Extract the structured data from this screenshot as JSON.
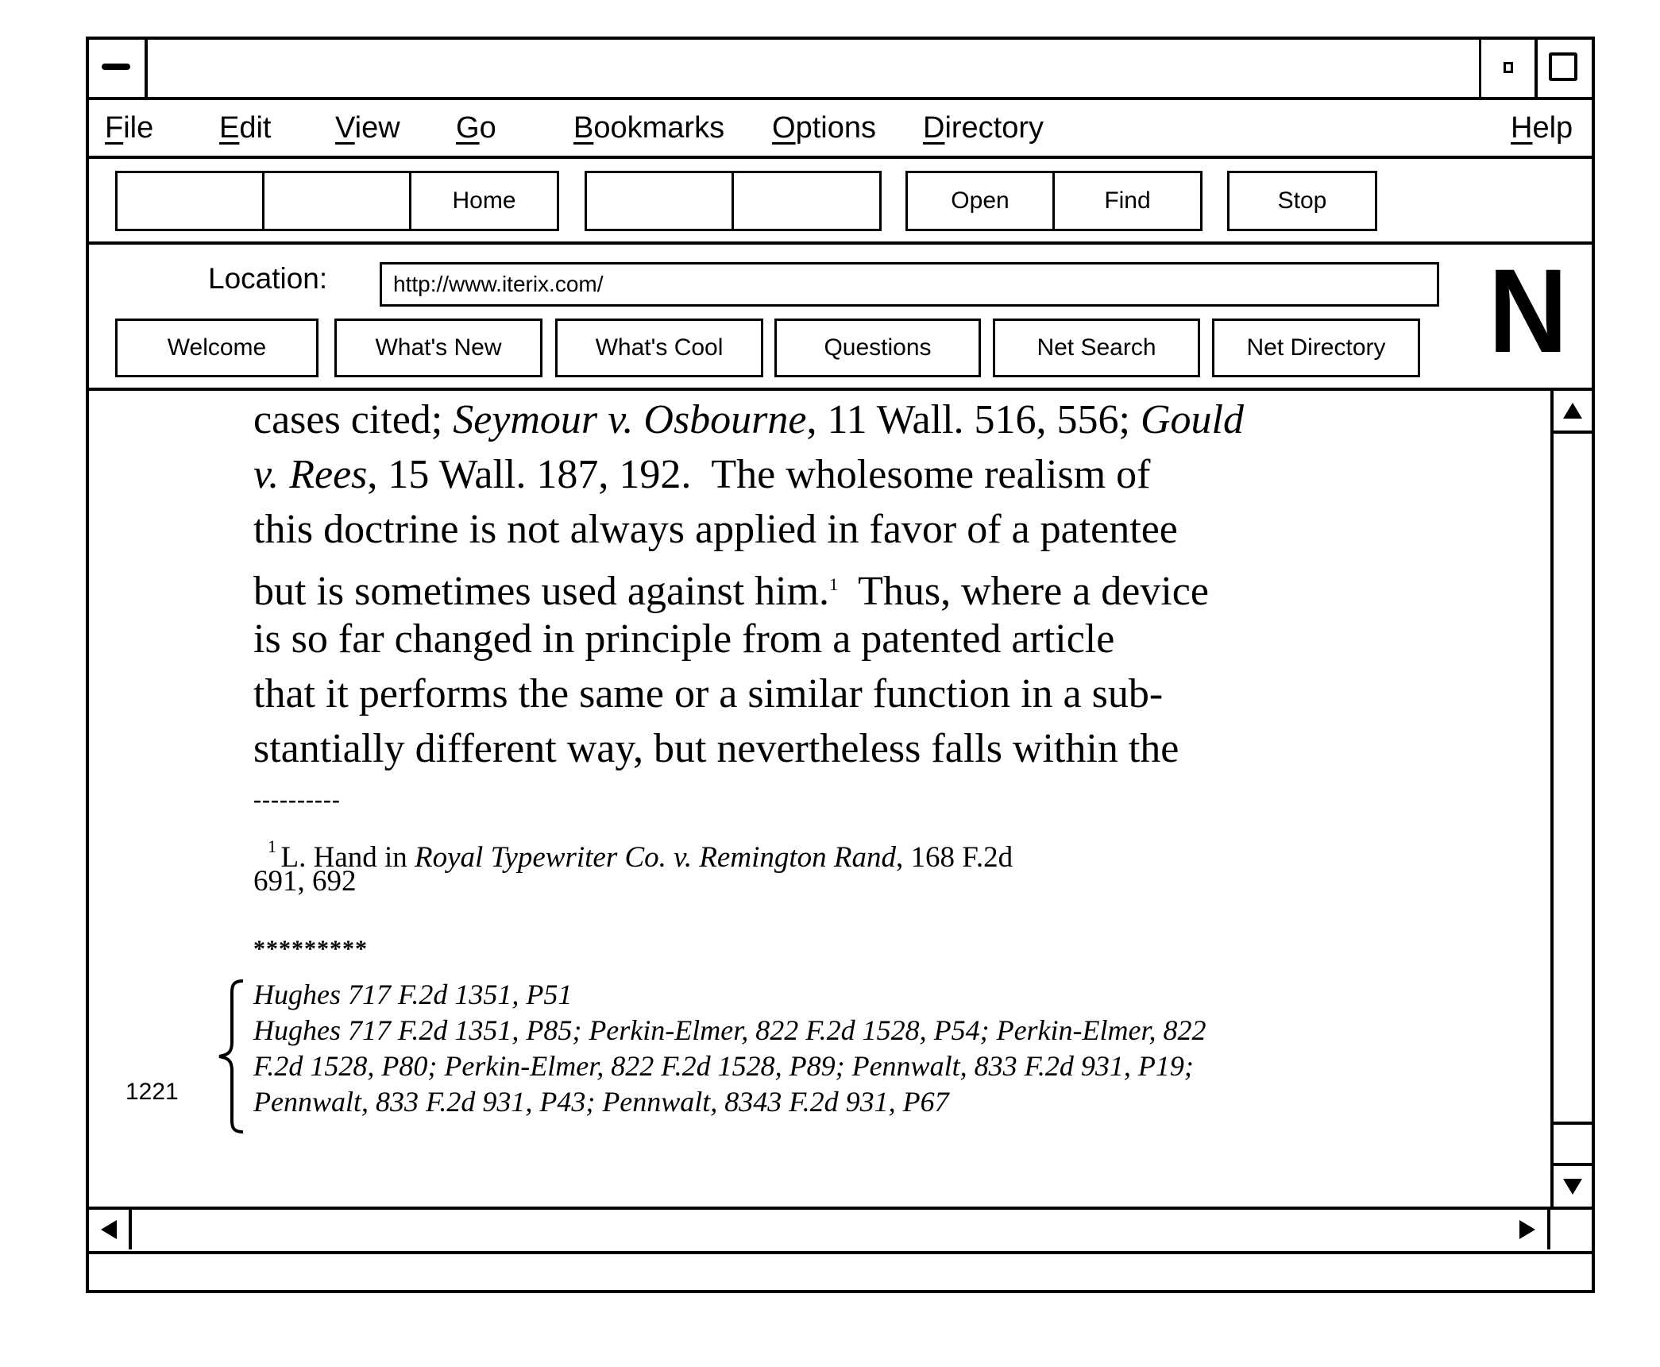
{
  "window": {
    "title": "",
    "controls": {
      "close": "window-menu",
      "minimize": "minimize",
      "maximize": "maximize"
    }
  },
  "menubar": {
    "items": [
      {
        "label": "File",
        "mnemonic": "F",
        "rest": "ile"
      },
      {
        "label": "Edit",
        "mnemonic": "E",
        "rest": "dit"
      },
      {
        "label": "View",
        "mnemonic": "V",
        "rest": "iew"
      },
      {
        "label": "Go",
        "mnemonic": "G",
        "rest": "o"
      },
      {
        "label": "Bookmarks",
        "mnemonic": "B",
        "rest": "ookmarks"
      },
      {
        "label": "Options",
        "mnemonic": "O",
        "rest": "ptions"
      },
      {
        "label": "Directory",
        "mnemonic": "D",
        "rest": "irectory"
      },
      {
        "label": "Help",
        "mnemonic": "H",
        "rest": "elp"
      }
    ]
  },
  "toolbar": {
    "buttons": [
      "",
      "",
      "Home",
      "",
      "",
      "Open",
      "Find",
      "Stop"
    ]
  },
  "location": {
    "label": "Location:",
    "url": "http://www.iterix.com/"
  },
  "nav_buttons": [
    "Welcome",
    "What's New",
    "What's Cool",
    "Questions",
    "Net Search",
    "Net Directory"
  ],
  "logo": "N",
  "document": {
    "body_lines": [
      [
        {
          "t": "cases cited; ",
          "i": false
        },
        {
          "t": "Seymour v. Osbourne",
          "i": true
        },
        {
          "t": ", 11 Wall. 516, 556; ",
          "i": false
        },
        {
          "t": "Gould",
          "i": true
        }
      ],
      [
        {
          "t": "v. Rees",
          "i": true
        },
        {
          "t": ", 15 Wall. 187, 192.  The wholesome realism of",
          "i": false
        }
      ],
      [
        {
          "t": "this doctrine is not always applied in favor of a patentee",
          "i": false
        }
      ],
      [
        {
          "t": "but is sometimes used against him.",
          "i": false
        },
        {
          "t": "1",
          "sup": true
        },
        {
          "t": "  Thus, where a device",
          "i": false
        }
      ],
      [
        {
          "t": "is so far changed in principle from a patented article",
          "i": false
        }
      ],
      [
        {
          "t": "that it performs the same or a similar function in a sub-",
          "i": false
        }
      ],
      [
        {
          "t": "stantially different way, but nevertheless falls within the",
          "i": false
        }
      ]
    ],
    "separator": "----------",
    "footnote": {
      "marker": "1",
      "parts": [
        {
          "t": "L. Hand in ",
          "i": false
        },
        {
          "t": "Royal Typewriter Co. v. Remington Rand",
          "i": true
        },
        {
          "t": ", 168 F.2d",
          "i": false
        }
      ],
      "continuation": "691, 692"
    },
    "stars": "*********",
    "reference_label": "1221",
    "citations": [
      "Hughes 717 F.2d 1351, P51",
      "Hughes 717 F.2d 1351, P85; Perkin-Elmer, 822 F.2d 1528, P54; Perkin-Elmer, 822",
      "F.2d 1528, P80; Perkin-Elmer, 822 F.2d 1528, P89; Pennwalt, 833 F.2d 931, P19;",
      "Pennwalt, 833 F.2d 931, P43; Pennwalt, 8343 F.2d 931, P67"
    ]
  },
  "status": {
    "text": ""
  }
}
